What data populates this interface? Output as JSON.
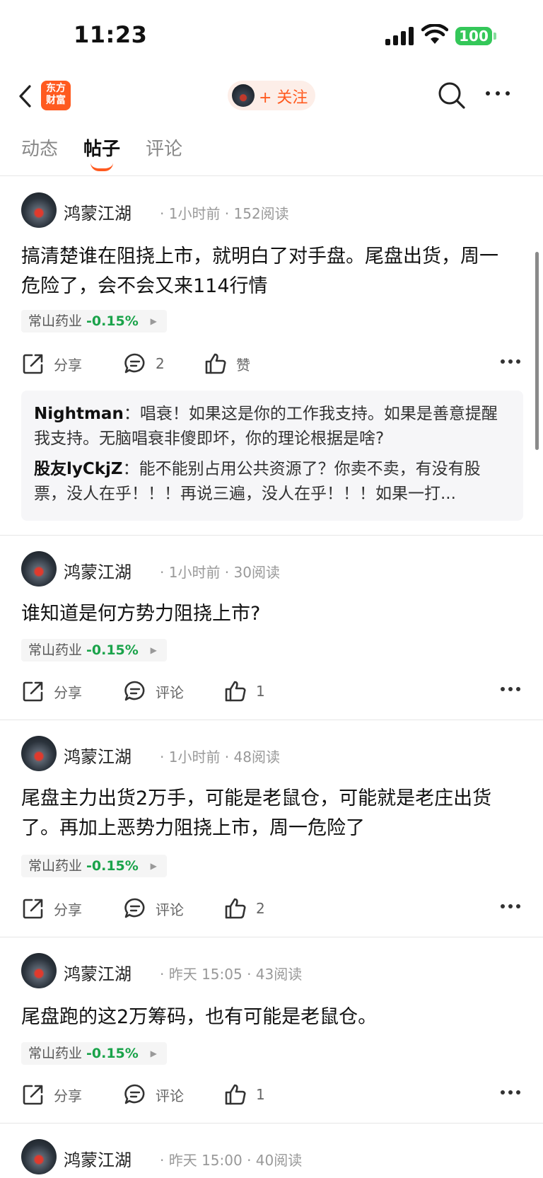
{
  "status_bar": {
    "time": "11:23",
    "battery": "100"
  },
  "nav": {
    "logo_line1": "东方",
    "logo_line2": "财富",
    "follow_label": "+ 关注"
  },
  "tabs": [
    {
      "label": "动态"
    },
    {
      "label": "帖子"
    },
    {
      "label": "评论"
    }
  ],
  "posts": [
    {
      "author": "鸿蒙江湖",
      "meta": "· 1小时前 · 152阅读",
      "body": "搞清楚谁在阻挠上市，就明白了对手盘。尾盘出货，周一危险了，会不会又来114行情",
      "stock": {
        "name": "常山药业",
        "change": "-0.15%"
      },
      "share_label": "分享",
      "comment_label": "2",
      "like_label": "赞",
      "comments": [
        {
          "name": "Nightman",
          "text": "：唱衰！如果这是你的工作我支持。如果是善意提醒我支持。无脑唱衰非傻即坏，你的理论根据是啥?"
        },
        {
          "name": "股友lyCkjZ",
          "text": "：能不能别占用公共资源了？你卖不卖，有没有股票，没人在乎！！！再说三遍，没人在乎！！！如果一打..."
        }
      ]
    },
    {
      "author": "鸿蒙江湖",
      "meta": "· 1小时前 · 30阅读",
      "body": "谁知道是何方势力阻挠上市?",
      "stock": {
        "name": "常山药业",
        "change": "-0.15%"
      },
      "share_label": "分享",
      "comment_label": "评论",
      "like_label": "1"
    },
    {
      "author": "鸿蒙江湖",
      "meta": "· 1小时前 · 48阅读",
      "body": "尾盘主力出货2万手，可能是老鼠仓，可能就是老庄出货了。再加上恶势力阻挠上市，周一危险了",
      "stock": {
        "name": "常山药业",
        "change": "-0.15%"
      },
      "share_label": "分享",
      "comment_label": "评论",
      "like_label": "2"
    },
    {
      "author": "鸿蒙江湖",
      "meta": "· 昨天 15:05 · 43阅读",
      "body": "尾盘跑的这2万筹码，也有可能是老鼠仓。",
      "stock": {
        "name": "常山药业",
        "change": "-0.15%"
      },
      "share_label": "分享",
      "comment_label": "评论",
      "like_label": "1"
    },
    {
      "author": "鸿蒙江湖",
      "meta": "· 昨天 15:00 · 40阅读"
    }
  ],
  "colors": {
    "accent": "#ff5a1f",
    "down_green": "#1aa34a"
  }
}
